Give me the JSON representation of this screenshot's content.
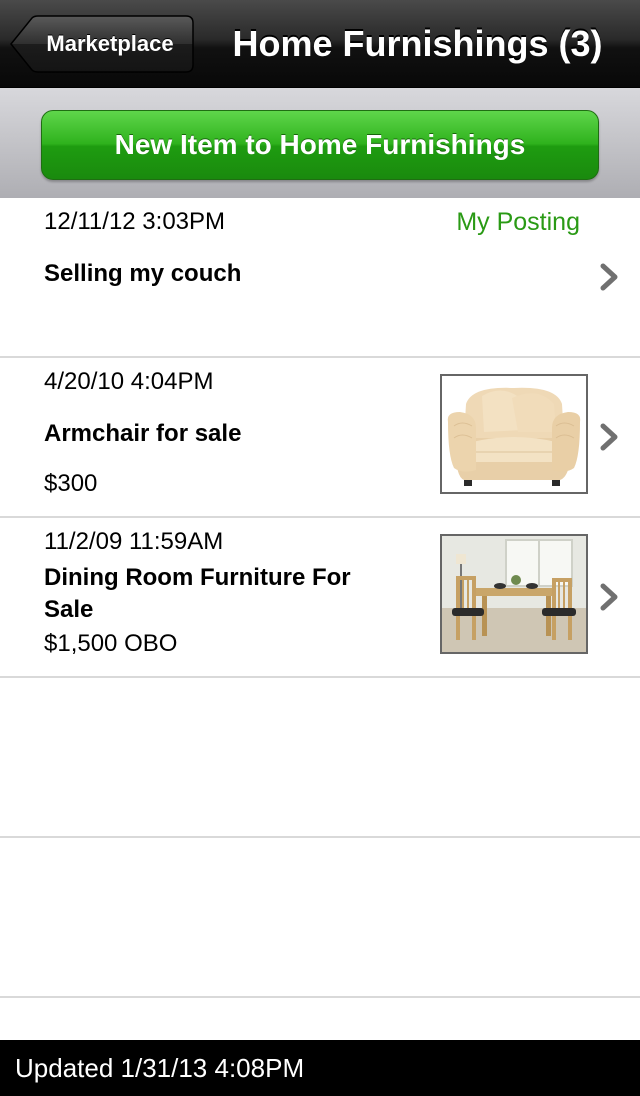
{
  "navbar": {
    "back_label": "Marketplace",
    "title": "Home Furnishings (3)"
  },
  "new_item_button": "New Item to Home Furnishings",
  "listings": [
    {
      "date": "12/11/12 3:03PM",
      "tag": "My Posting",
      "title": "Selling my couch",
      "price": ""
    },
    {
      "date": "4/20/10 4:04PM",
      "title": "Armchair for sale",
      "price": "$300",
      "thumbnail": "armchair-photo"
    },
    {
      "date": "11/2/09 11:59AM",
      "title": "Dining Room Furniture For Sale",
      "price": "$1,500 OBO",
      "thumbnail": "dining-room-photo"
    }
  ],
  "footer": {
    "updated": "Updated 1/31/13 4:08PM"
  },
  "colors": {
    "accent_green": "#2fb21d",
    "my_posting": "#2a9a15",
    "navbar": "#111111"
  }
}
